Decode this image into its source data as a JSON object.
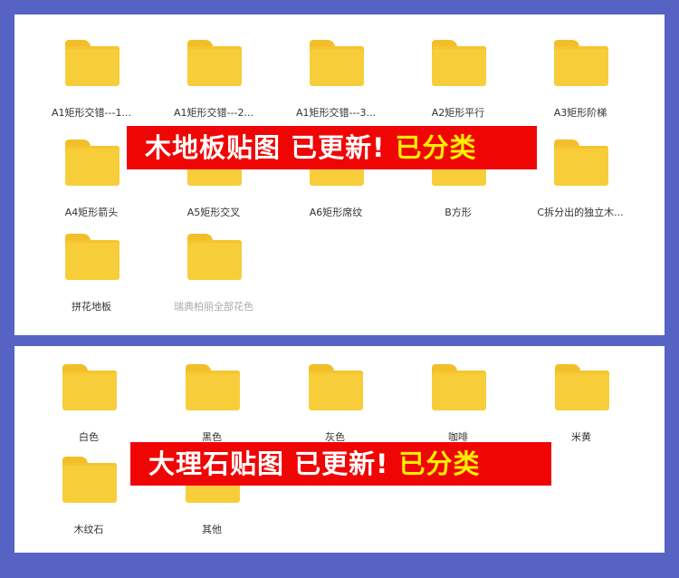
{
  "top_panel": {
    "folders": [
      {
        "label": "A1矩形交错---1..."
      },
      {
        "label": "A1矩形交错---2..."
      },
      {
        "label": "A1矩形交错---3..."
      },
      {
        "label": "A2矩形平行"
      },
      {
        "label": "A3矩形阶梯"
      },
      {
        "label": "A4矩形箭头"
      },
      {
        "label": "A5矩形交叉"
      },
      {
        "label": "A6矩形席纹"
      },
      {
        "label": "B方形"
      },
      {
        "label": "C拆分出的独立木..."
      },
      {
        "label": "拼花地板"
      },
      {
        "label": "瑞典柏丽全部花色"
      }
    ],
    "banner": {
      "text": "木地板贴图 已更新!",
      "highlight": "已分类"
    }
  },
  "bottom_panel": {
    "folders": [
      {
        "label": "白色"
      },
      {
        "label": "黑色"
      },
      {
        "label": "灰色"
      },
      {
        "label": "咖啡"
      },
      {
        "label": "米黄"
      },
      {
        "label": "木纹石"
      },
      {
        "label": "其他"
      }
    ],
    "banner": {
      "text": "大理石贴图  已更新!",
      "highlight": "已分类"
    }
  },
  "colors": {
    "background": "#5663c4",
    "banner_red": "#f00505",
    "highlight_yellow": "#ffee00",
    "folder_yellow": "#f8cd3a"
  },
  "icons": {
    "folder": "folder-icon"
  }
}
